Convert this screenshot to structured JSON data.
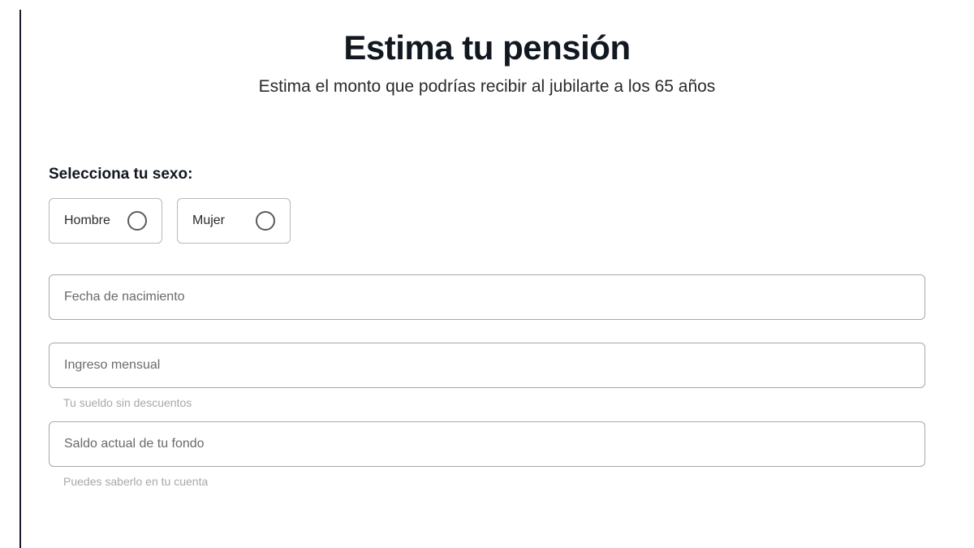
{
  "header": {
    "title": "Estima tu pensión",
    "subtitle": "Estima el monto que podrías recibir al jubilarte a los 65 años"
  },
  "form": {
    "gender": {
      "label": "Selecciona tu sexo:",
      "options": [
        {
          "label": "Hombre"
        },
        {
          "label": "Mujer"
        }
      ]
    },
    "fields": {
      "birthdate": {
        "placeholder": "Fecha de nacimiento"
      },
      "income": {
        "placeholder": "Ingreso mensual",
        "helper": "Tu sueldo sin descuentos"
      },
      "balance": {
        "placeholder": "Saldo actual de tu fondo",
        "helper": "Puedes saberlo en tu cuenta"
      }
    }
  }
}
